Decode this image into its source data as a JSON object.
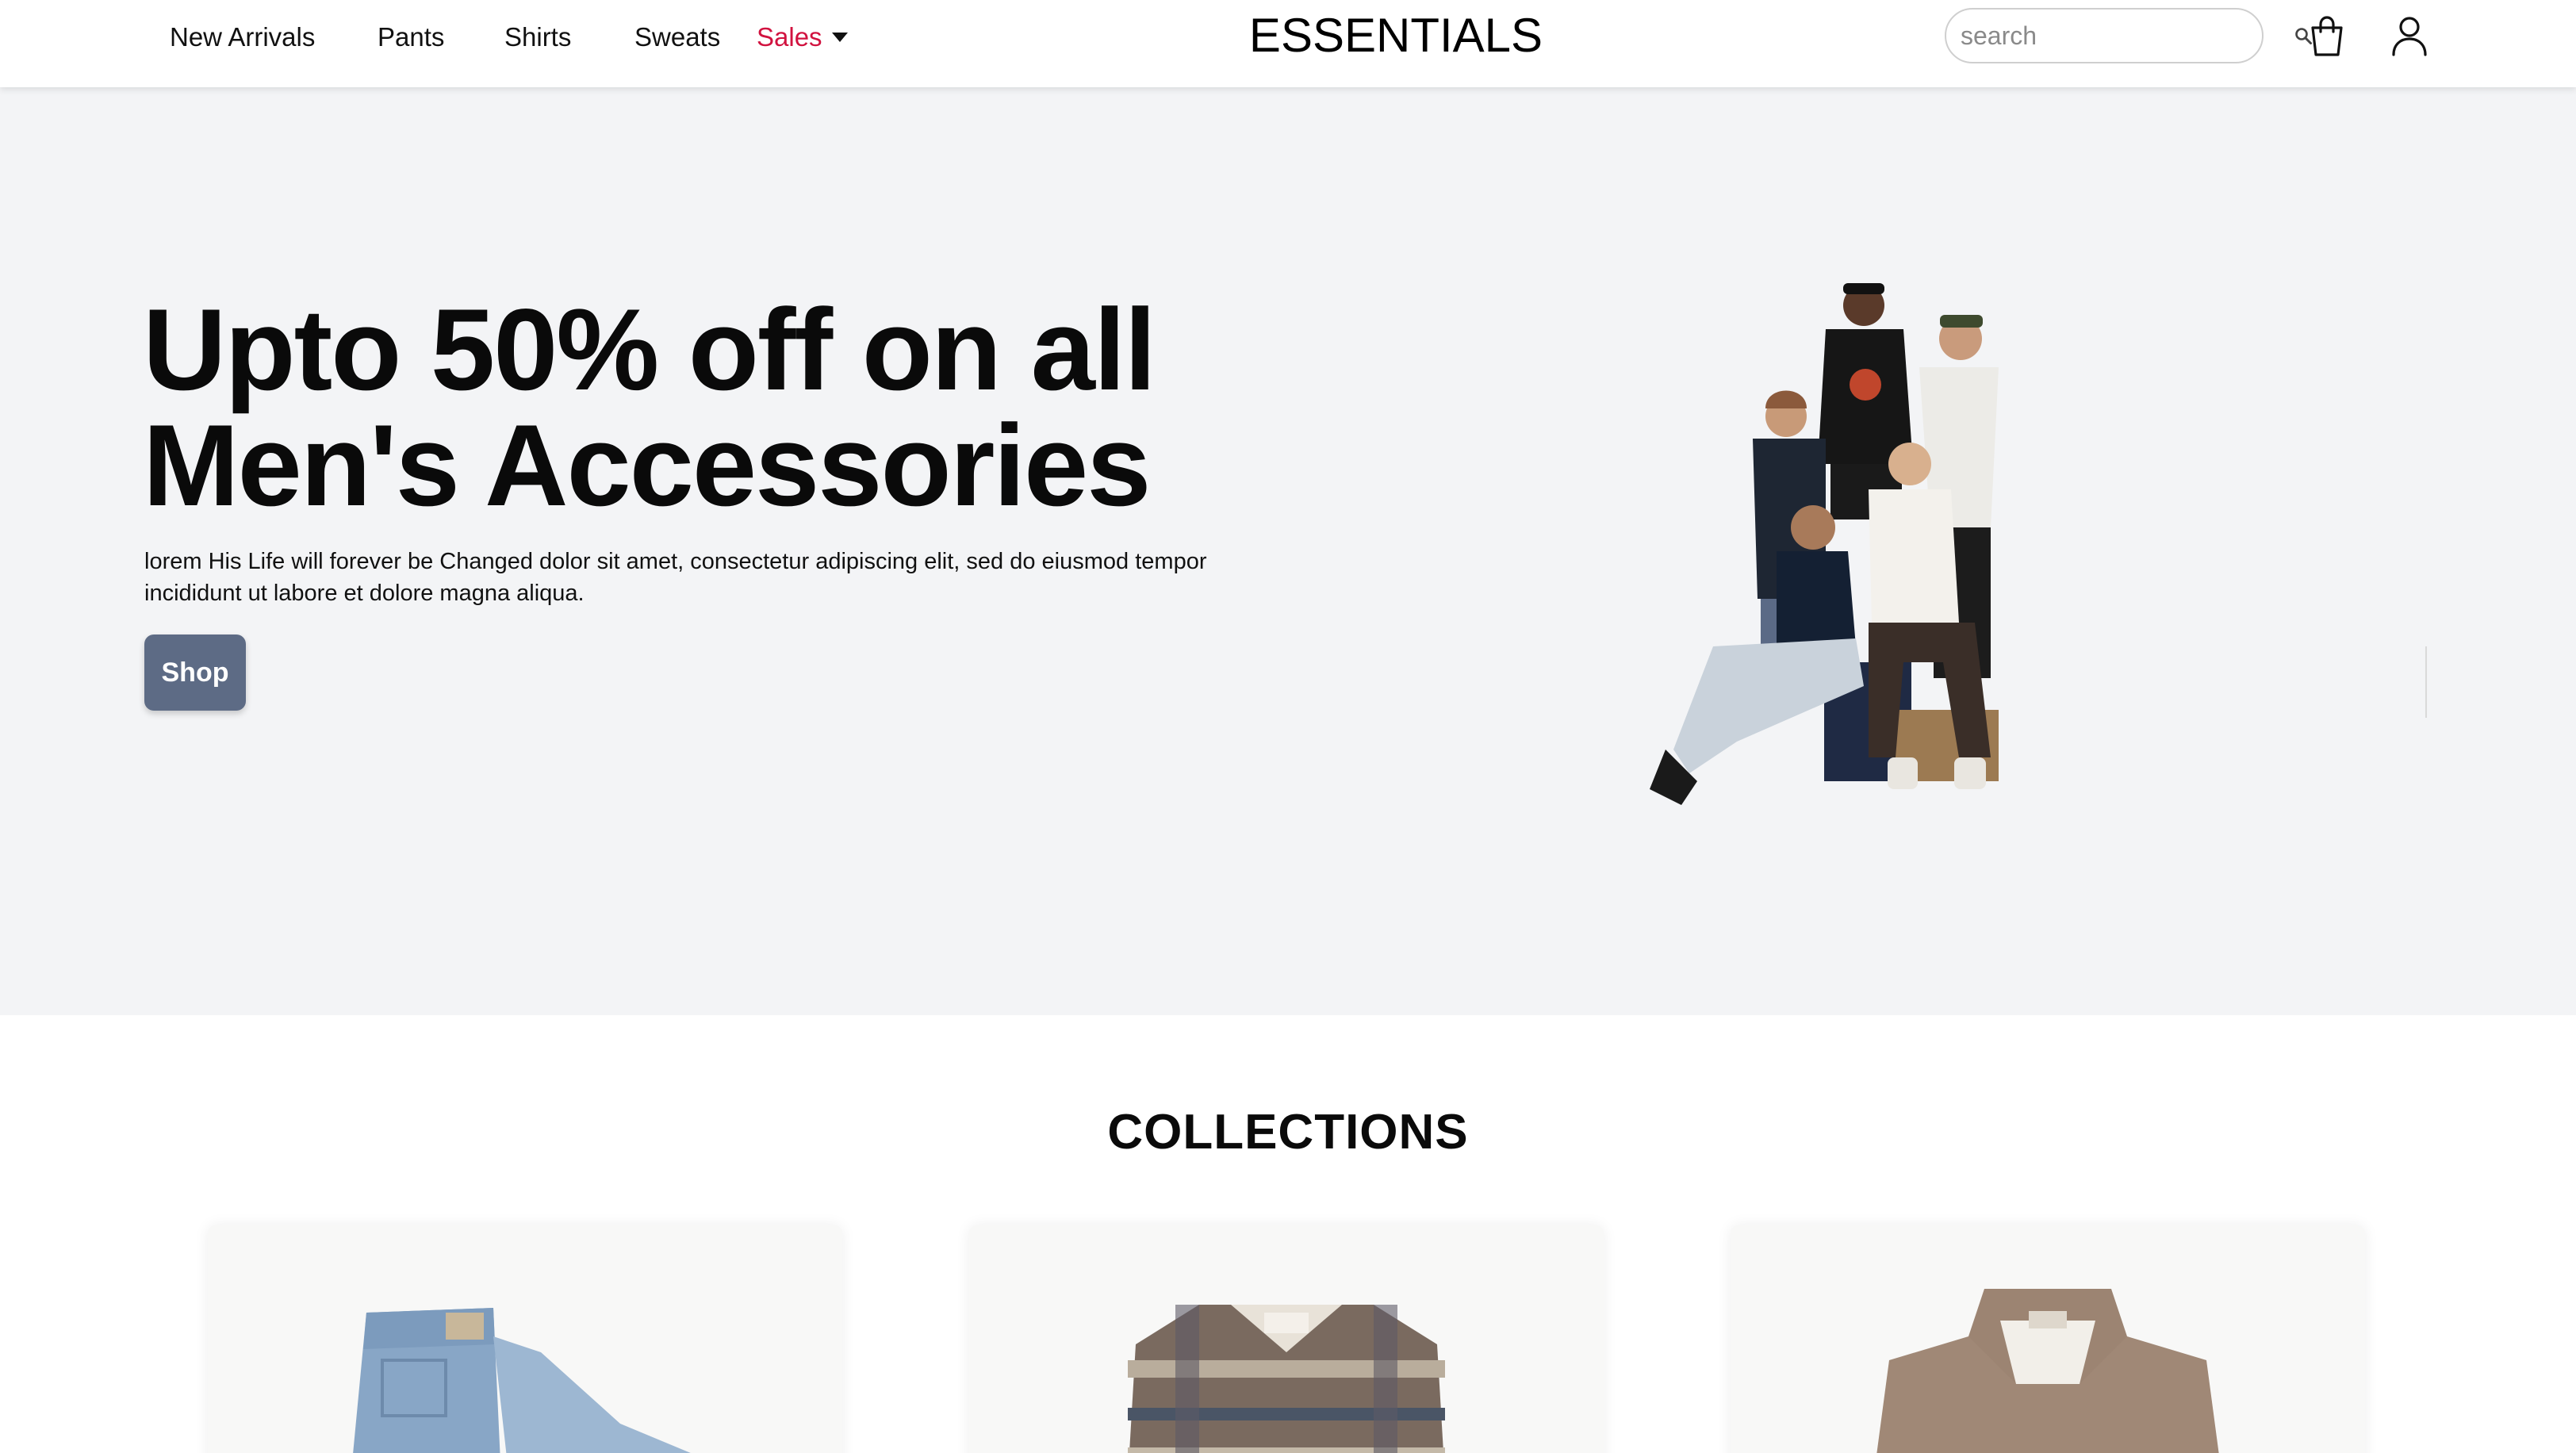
{
  "header": {
    "nav": [
      {
        "label": "New Arrivals"
      },
      {
        "label": "Pants"
      },
      {
        "label": "Shirts"
      },
      {
        "label": "Sweats"
      },
      {
        "label": "Sales",
        "color": "#d1123f"
      }
    ],
    "brand": "ESSENTIALS",
    "search": {
      "placeholder": "search",
      "value": ""
    },
    "icons": [
      "search-icon",
      "shopping-bag-icon",
      "user-icon"
    ]
  },
  "hero": {
    "title_line1": "Upto 50% off on all",
    "title_line2": "Men's Accessories",
    "description": "lorem His Life will forever be Changed dolor sit amet, consectetur adipiscing elit, sed do eiusmod tempor incididunt ut labore et dolore magna aliqua.",
    "shop_button": "Shop",
    "button_color": "#5d6b85",
    "background": "#f3f4f6"
  },
  "collections": {
    "title": "COLLECTIONS",
    "cards": [
      {
        "image": "jeans"
      },
      {
        "image": "flannel-shirt"
      },
      {
        "image": "fleece-pullover"
      }
    ]
  }
}
